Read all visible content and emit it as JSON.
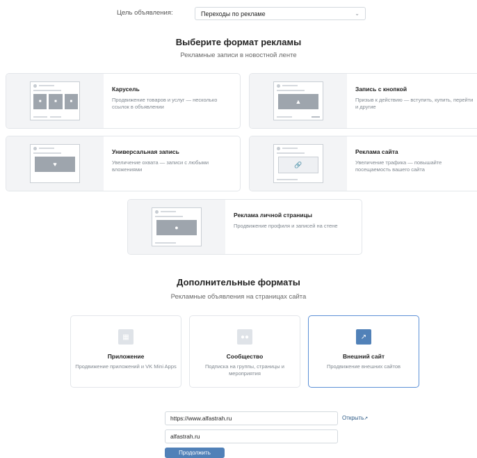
{
  "goal": {
    "label": "Цель объявления:",
    "value": "Переходы по рекламе",
    "chevron": "chevron-down-icon"
  },
  "formats": {
    "title": "Выберите формат рекламы",
    "subtitle": "Рекламные записи в новостной ленте",
    "cards": [
      {
        "title": "Карусель",
        "desc": "Продвижение товаров и услуг — несколько ссылок в объявлении",
        "icon": "carousel-preview"
      },
      {
        "title": "Запись с кнопкой",
        "desc": "Призыв к действию — вступить, купить, перейти и другие",
        "icon": "button-post-preview"
      },
      {
        "title": "Универсальная запись",
        "desc": "Увеличение охвата — записи с любыми вложениями",
        "icon": "universal-post-preview"
      },
      {
        "title": "Реклама сайта",
        "desc": "Увеличение трафика — повышайте посещаемость вашего сайта",
        "icon": "site-ad-preview"
      },
      {
        "title": "Реклама личной страницы",
        "desc": "Продвижение профиля и записей на стене",
        "icon": "personal-page-preview"
      }
    ]
  },
  "additional": {
    "title": "Дополнительные форматы",
    "subtitle": "Рекламные объявления на страницах сайта",
    "cards": [
      {
        "title": "Приложение",
        "desc": "Продвижение приложений и VK Mini Apps",
        "icon": "gamepad-icon",
        "selected": false
      },
      {
        "title": "Сообщество",
        "desc": "Подписка на группы, страницы и мероприятия",
        "icon": "community-icon",
        "selected": false
      },
      {
        "title": "Внешний сайт",
        "desc": "Продвижение внешних сайтов",
        "icon": "external-link-icon",
        "selected": true
      }
    ]
  },
  "link": {
    "url": "https://www.alfastrah.ru",
    "open_label": "Открыть",
    "domain": "alfastrah.ru",
    "continue_label": "Продолжить"
  },
  "colors": {
    "accent": "#5181b8",
    "selected_border": "#5b8fd6",
    "link": "#2a5885"
  }
}
